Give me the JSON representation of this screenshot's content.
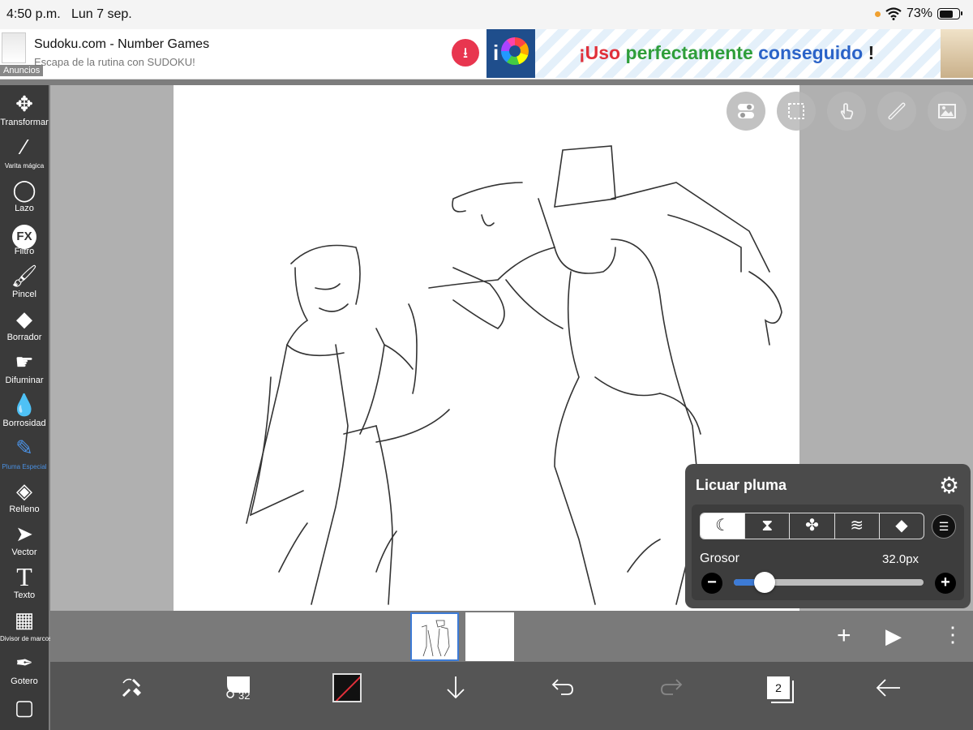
{
  "status_bar": {
    "time": "4:50 p.m.",
    "date": "Lun 7 sep.",
    "battery": "73%",
    "battery_level": 0.73
  },
  "ad": {
    "title": "Sudoku.com - Number Games",
    "subtitle": "Escapa de la rutina con SUDOKU!",
    "label": "Anuncios",
    "promo_parts": [
      "¡Uso",
      "perfectamente",
      "conseguido",
      "!"
    ]
  },
  "toolbar": {
    "items": [
      {
        "label": "Transformar",
        "icon": "move-icon"
      },
      {
        "label": "Varita mágica",
        "icon": "magic-wand-icon"
      },
      {
        "label": "Lazo",
        "icon": "lasso-icon"
      },
      {
        "label": "Filtro",
        "icon": "fx-icon"
      },
      {
        "label": "Pincel",
        "icon": "brush-icon"
      },
      {
        "label": "Borrador",
        "icon": "eraser-icon"
      },
      {
        "label": "Difuminar",
        "icon": "smudge-icon"
      },
      {
        "label": "Borrosidad",
        "icon": "blur-drop-icon"
      },
      {
        "label": "Pluma Especial",
        "icon": "special-pen-icon",
        "active": true
      },
      {
        "label": "Relleno",
        "icon": "fill-icon"
      },
      {
        "label": "Vector",
        "icon": "cursor-icon"
      },
      {
        "label": "Texto",
        "icon": "text-icon"
      },
      {
        "label": "Divisor de marcos",
        "icon": "frame-divider-icon"
      },
      {
        "label": "Gotero",
        "icon": "eyedropper-icon"
      }
    ],
    "active_color": "#4a90e2"
  },
  "brush_panel": {
    "title": "Licuar pluma",
    "thickness_label": "Grosor",
    "thickness_value": "32.0px",
    "slider_fraction": 0.13,
    "modes": [
      "moon-icon",
      "hourglass-icon",
      "clover-icon",
      "wifi-brush-icon",
      "eraser-icon"
    ],
    "active_mode": 0
  },
  "bottom_bar": {
    "brush_size": "32",
    "layers_count": "2",
    "current_color": "#111111"
  }
}
